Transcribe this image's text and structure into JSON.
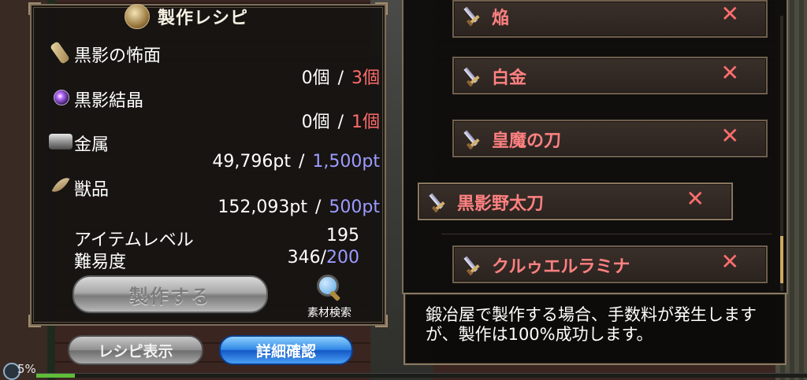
{
  "panel": {
    "title": "製作レシピ",
    "title_icon": "anvil-icon"
  },
  "materials": [
    {
      "name": "黒影の怖面",
      "have": "0個",
      "sep": "/",
      "need": "3個",
      "icon": "mask-scroll-icon",
      "need_color": "#ff6b6b"
    },
    {
      "name": "黒影結晶",
      "have": "0個",
      "sep": "/",
      "need": "1個",
      "icon": "crystal-orb-icon",
      "need_color": "#ff6b6b"
    },
    {
      "name": "金属",
      "have": "49,796pt",
      "sep": "/",
      "need": "1,500pt",
      "icon": "metal-ingot-icon",
      "need_color": "#9c9cff"
    },
    {
      "name": "獣品",
      "have": "152,093pt",
      "sep": "/",
      "need": "500pt",
      "icon": "fang-icon",
      "need_color": "#9c9cff"
    }
  ],
  "stats": {
    "item_level_label": "アイテムレベル",
    "item_level_value": "195",
    "difficulty_label": "難易度",
    "difficulty_value": "346/",
    "difficulty_max": "200"
  },
  "buttons": {
    "craft": "製作する",
    "search_materials": "素材検索",
    "recipe_view": "レシピ表示",
    "details": "詳細確認"
  },
  "status": {
    "percent": "5%"
  },
  "ingredients": [
    {
      "name": "焔",
      "mark": "✕",
      "icon": "sword-icon"
    },
    {
      "name": "白金",
      "mark": "✕",
      "icon": "sword-icon"
    },
    {
      "name": "皇魔の刀",
      "mark": "✕",
      "icon": "sword-icon"
    },
    {
      "name": "黒影野太刀",
      "mark": "✕",
      "icon": "sword-icon"
    },
    {
      "name": "クルゥエルラミナ",
      "mark": "✕",
      "icon": "sword-icon"
    }
  ],
  "message": "鍛冶屋で製作する場合、手数料が発生しますが、製作は100%成功します。",
  "colors": {
    "lack": "#ff6b6b",
    "ok": "#9c9cff",
    "ingredient_name": "#ff8181"
  }
}
